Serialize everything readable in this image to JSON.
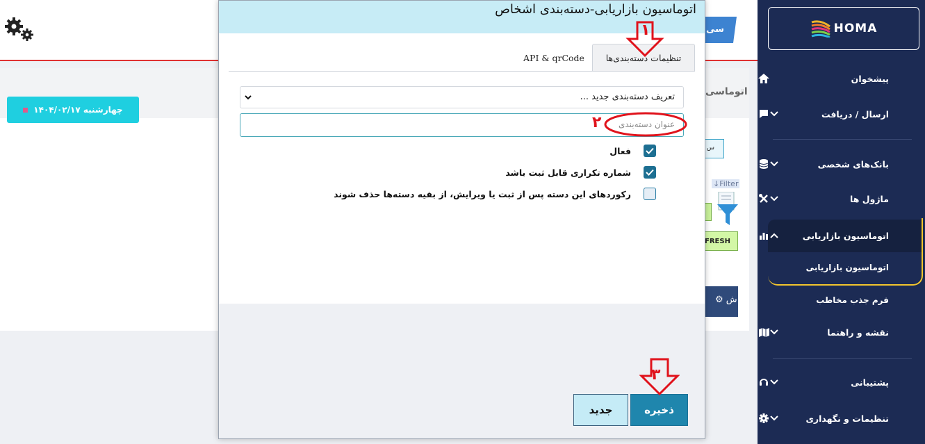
{
  "background": {
    "tab_peek": "سی",
    "date_label": "چهارشنبه ۱۴۰۴/۰۲/۱۷",
    "page_title_peek": "اتوماسی",
    "small_btn": "س",
    "filter_label": "Filter",
    "green_btn_label": "FRESH",
    "dark_btn_label": "⚙ ش"
  },
  "sidebar": {
    "logo_text": "HOMA",
    "items": [
      {
        "label": "پیشخوان",
        "icon": "home-icon"
      },
      {
        "label": "ارسال / دریافت",
        "icon": "chat-icon"
      },
      {
        "label": "بانک‌های شخصی",
        "icon": "database-icon"
      },
      {
        "label": "ماژول ها",
        "icon": "tools-icon"
      },
      {
        "label": "اتوماسیون بازاریابی",
        "icon": "chart-icon"
      },
      {
        "label": "نقشه و راهنما",
        "icon": "map-icon"
      },
      {
        "label": "پشتیبانی",
        "icon": "headset-icon"
      },
      {
        "label": "تنظیمات و نگهداری",
        "icon": "gear-icon"
      }
    ],
    "sub_items": [
      "اتوماسیون بازاریابی",
      "فرم جذب مخاطب"
    ]
  },
  "modal": {
    "title": "اتوماسیون بازاریابی-دسته‌بندی اشخاص",
    "tabs": [
      "تنظیمات دسته‌بندی‌ها",
      "API & qrCode"
    ],
    "select_value": "تعریف دسته‌بندی جدید ...",
    "title_input_placeholder": "عنوان دسته‌بندی",
    "checkboxes": [
      {
        "label": "فعال",
        "checked": true
      },
      {
        "label": "شماره تکراری قابل ثبت باشد",
        "checked": true
      },
      {
        "label": "رکوردهای این دسته پس از ثبت یا ویرایش، از بقیه دسته‌ها حذف شوند",
        "checked": false
      }
    ],
    "save_label": "ذخیره",
    "new_label": "جدید"
  },
  "annotations": {
    "n1": "۱",
    "n2": "۲",
    "n3": "۳"
  },
  "colors": {
    "sidebar_bg": "#1c2b54",
    "modal_header": "#c7ecf6",
    "save_btn": "#1f86ad",
    "accent_red": "#e0131c",
    "active_border": "#f2c52d",
    "date_btn": "#1fcfe0"
  }
}
